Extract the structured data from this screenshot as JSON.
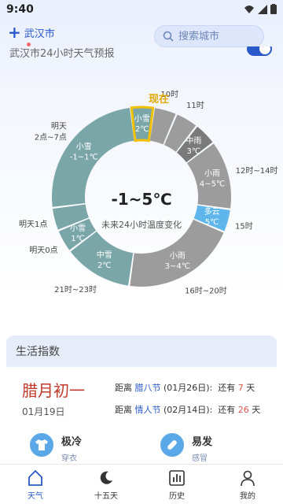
{
  "status_bar": {
    "time": "9:40"
  },
  "header": {
    "add_symbol": "+",
    "city": "武汉市",
    "search_placeholder": "搜索城市"
  },
  "forecast": {
    "label": "武汉市24小时天气预报"
  },
  "donut": {
    "center_temp": "-1~5℃",
    "center_caption": "未来24小时温度变化",
    "now_label": "现在",
    "segments": [
      {
        "weather": "小雪",
        "temp": "2℃",
        "color": "#7aa6a8",
        "time": "",
        "span": 1,
        "highlight": true
      },
      {
        "weather": "",
        "temp": "",
        "color": "#9c9c9c",
        "time": "10时",
        "span": 1
      },
      {
        "weather": "",
        "temp": "",
        "color": "#9c9c9c",
        "time": "11时",
        "span": 1
      },
      {
        "weather": "中雨",
        "temp": "3℃",
        "color": "#7a7a7a",
        "time": "",
        "span": 1
      },
      {
        "weather": "小雨",
        "temp": "4~5℃",
        "color": "#9c9c9c",
        "time": "12时~14时",
        "span": 3
      },
      {
        "weather": "多云",
        "temp": "5℃",
        "color": "#5fb6ec",
        "time": "15时",
        "span": 1
      },
      {
        "weather": "小雨",
        "temp": "3~4℃",
        "color": "#9c9c9c",
        "time": "16时~20时",
        "span": 5
      },
      {
        "weather": "中雪",
        "temp": "2℃",
        "color": "#7aa6a8",
        "time": "21时~23时",
        "span": 3
      },
      {
        "weather": "小雪",
        "temp": "1℃",
        "color": "#7aa6a8",
        "time": "明天0点",
        "span": 1
      },
      {
        "weather": "",
        "temp": "",
        "color": "#7aa6a8",
        "time": "明天1点",
        "span": 1
      },
      {
        "weather": "小雪",
        "temp": "-1~1℃",
        "color": "#7aa6a8",
        "time": "明天\n2点~7点",
        "span": 6
      }
    ]
  },
  "life": {
    "title": "生活指数",
    "lunar": "腊月初一",
    "solar": "01月19日",
    "festivals": [
      {
        "prefix": "距离",
        "name": "腊八节",
        "date": "(01月26日):",
        "remain_label": "还有",
        "days": "7",
        "unit": "天"
      },
      {
        "prefix": "距离",
        "name": "情人节",
        "date": "(02月14日):",
        "remain_label": "还有",
        "days": "26",
        "unit": "天"
      }
    ],
    "indices": [
      {
        "title": "极冷",
        "sub": "穿衣",
        "icon": "tshirt-icon"
      },
      {
        "title": "易发",
        "sub": "感冒",
        "icon": "pill-icon"
      }
    ]
  },
  "nav": {
    "items": [
      {
        "label": "天气",
        "icon": "house-icon",
        "active": true
      },
      {
        "label": "十五天",
        "icon": "moon-icon",
        "active": false
      },
      {
        "label": "历史",
        "icon": "chart-icon",
        "active": false
      },
      {
        "label": "我的",
        "icon": "person-icon",
        "active": false
      }
    ]
  }
}
